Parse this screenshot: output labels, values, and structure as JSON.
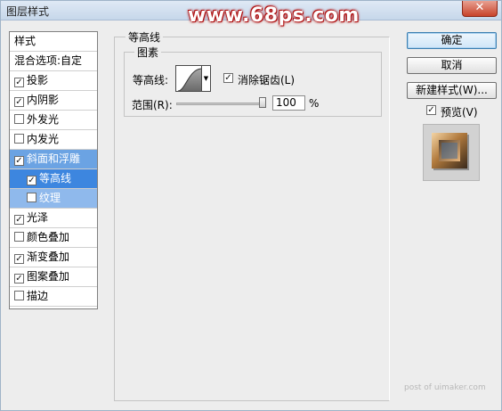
{
  "window": {
    "title": "图层样式",
    "close_label": "✕"
  },
  "watermark": "www.68ps.com",
  "style_list": {
    "header": "样式",
    "blend_options": "混合选项:自定",
    "items": [
      {
        "label": "投影",
        "checked": true
      },
      {
        "label": "内阴影",
        "checked": true
      },
      {
        "label": "外发光",
        "checked": false
      },
      {
        "label": "内发光",
        "checked": false
      },
      {
        "label": "斜面和浮雕",
        "checked": true
      },
      {
        "label": "等高线",
        "checked": true
      },
      {
        "label": "纹理",
        "checked": false
      },
      {
        "label": "光泽",
        "checked": true
      },
      {
        "label": "颜色叠加",
        "checked": false
      },
      {
        "label": "渐变叠加",
        "checked": true
      },
      {
        "label": "图案叠加",
        "checked": true
      },
      {
        "label": "描边",
        "checked": false
      }
    ]
  },
  "panel": {
    "group_title": "等高线",
    "subgroup_title": "图素",
    "contour_label": "等高线:",
    "antialias_label": "消除锯齿(L)",
    "antialias_checked": true,
    "range_label": "范围(R):",
    "range_value": "100",
    "range_unit": "%",
    "range_level": 1.0
  },
  "buttons": {
    "ok": "确定",
    "cancel": "取消",
    "new_style": "新建样式(W)...",
    "preview_label": "预览(V)",
    "preview_checked": true
  },
  "footer": "post of uimaker.com",
  "checkmark": "✓"
}
